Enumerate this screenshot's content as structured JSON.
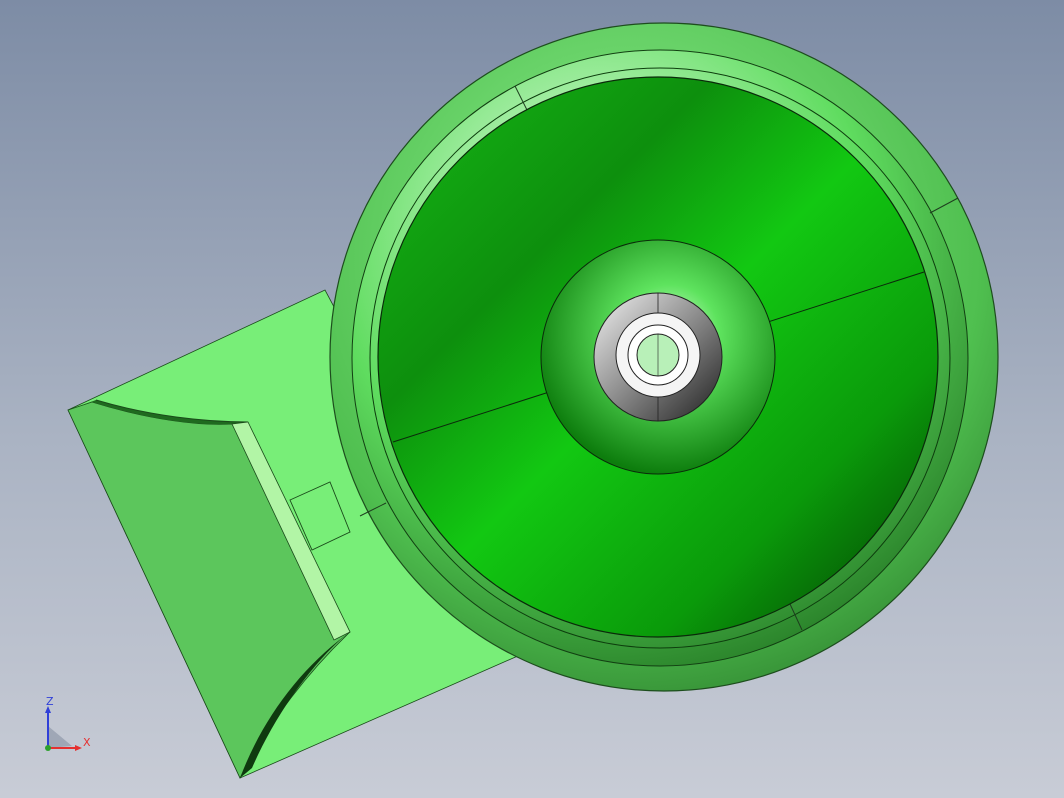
{
  "viewport": {
    "triad": {
      "z_label": "Z",
      "x_label": "X"
    }
  },
  "colors": {
    "background_top": "#7d8ca5",
    "background_bottom": "#c8ccd6",
    "model_green": "#6fe36f",
    "model_green_dark": "#0f6e0f",
    "hub_steel": "#8a8a8a",
    "axis_x": "#e53030",
    "axis_y": "#2ca02c",
    "axis_z": "#2f3fd8"
  }
}
